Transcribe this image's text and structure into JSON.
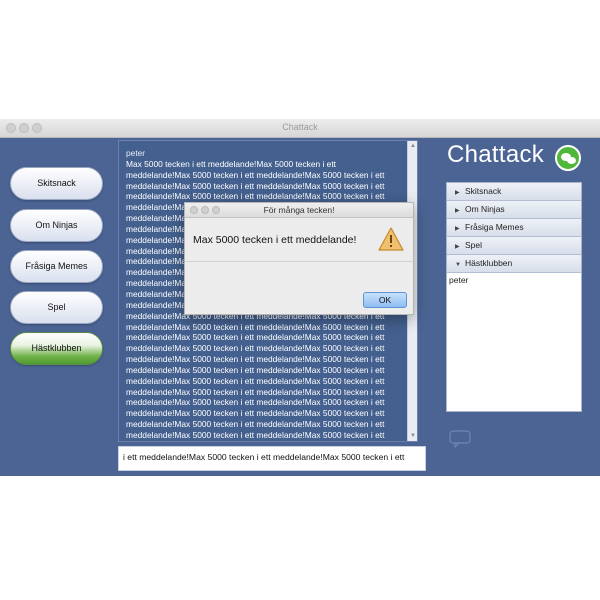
{
  "window": {
    "title": "Chattack"
  },
  "rooms": [
    {
      "label": "Skitsnack",
      "active": false
    },
    {
      "label": "Om Ninjas",
      "active": false
    },
    {
      "label": "Fråsiga Memes",
      "active": false
    },
    {
      "label": "Spel",
      "active": false
    },
    {
      "label": "Hästklubben",
      "active": true
    }
  ],
  "chat": {
    "sender": "peter",
    "first_line": "Max 5000 tecken i ett meddelande!Max 5000 tecken i ett",
    "lines": [
      "meddelande!Max 5000 tecken i ett meddelande!Max 5000 tecken i ett",
      "meddelande!Max 5000 tecken i ett meddelande!Max 5000 tecken i ett",
      "meddelande!Max 5000 tecken i ett meddelande!Max 5000 tecken i ett",
      "meddelande!Max 5000 tecken i ett meddelande!Max 5000 tecken i ett",
      "meddelande!Max 5000 tecken i ett meddelande!Max 5000 tecken i ett",
      "meddelande!Max 5000 tecken i ett meddelande!Max 5000 tecken i ett",
      "meddelande!Max 5000 tecken i ett meddelande!Max 5000 tecken i ett",
      "meddelande!Max 5000 tecken i ett meddelande!Max 5000 tecken i ett",
      "meddelande!Max 5000 tecken i ett meddelande!Max 5000 tecken i ett",
      "meddelande!Max 5000 tecken i ett meddelande!Max 5000 tecken i ett",
      "meddelande!Max 5000 tecken i ett meddelande!Max 5000 tecken i ett",
      "meddelande!Max 5000 tecken i ett meddelande!Max 5000 tecken i ett",
      "meddelande!Max 5000 tecken i ett meddelande!Max 5000 tecken i ett",
      "meddelande!Max 5000 tecken i ett meddelande!Max 5000 tecken i ett",
      "meddelande!Max 5000 tecken i ett meddelande!Max 5000 tecken i ett",
      "meddelande!Max 5000 tecken i ett meddelande!Max 5000 tecken i ett",
      "meddelande!Max 5000 tecken i ett meddelande!Max 5000 tecken i ett",
      "meddelande!Max 5000 tecken i ett meddelande!Max 5000 tecken i ett",
      "meddelande!Max 5000 tecken i ett meddelande!Max 5000 tecken i ett",
      "meddelande!Max 5000 tecken i ett meddelande!Max 5000 tecken i ett",
      "meddelande!Max 5000 tecken i ett meddelande!Max 5000 tecken i ett",
      "meddelande!Max 5000 tecken i ett meddelande!Max 5000 tecken i ett",
      "meddelande!Max 5000 tecken i ett meddelande!Max 5000 tecken i ett",
      "meddelande!Max 5000 tecken i ett meddelande!Max 5000 tecken i ett",
      "meddelande!Max 5000 tecken i ett meddelande!Max 5000 tecken i ett",
      "meddelande!Max 5000 tecken i ett meddelande!Max 5000 tecken i ett"
    ]
  },
  "input": {
    "value": "i ett meddelande!Max 5000 tecken i ett meddelande!Max 5000 tecken i ett"
  },
  "logo": {
    "text": "Chattack"
  },
  "room_tree": {
    "rows": [
      {
        "label": "Skitsnack",
        "expanded": false
      },
      {
        "label": "Om Ninjas",
        "expanded": false
      },
      {
        "label": "Fråsiga Memes",
        "expanded": false
      },
      {
        "label": "Spel",
        "expanded": false
      },
      {
        "label": "Hästklubben",
        "expanded": true
      }
    ],
    "members": [
      "peter"
    ]
  },
  "dialog": {
    "title": "För många tecken!",
    "message": "Max 5000 tecken i ett meddelande!",
    "ok_label": "OK",
    "icon": "warning-icon"
  },
  "colors": {
    "window_bg": "#4b6494",
    "chat_bg": "#44608f",
    "active_room": "#6fb24a",
    "logo_green": "#4fb83a"
  }
}
